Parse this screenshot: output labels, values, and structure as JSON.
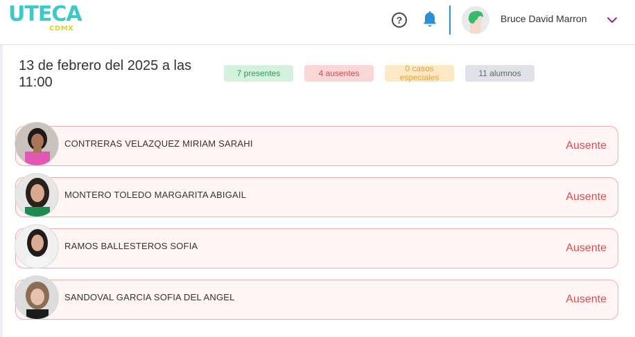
{
  "header": {
    "logo_main": "UTECA",
    "logo_sub": "CDMX",
    "help_glyph": "?",
    "user_name": "Bruce David Marron",
    "icons": [
      "question-icon",
      "bell-icon",
      "chevron-down-icon"
    ]
  },
  "title": "13 de febrero del 2025 a las 11:00",
  "badges": {
    "present": "7 presentes",
    "absent": "4 ausentes",
    "special": "0 casos especiales",
    "students": "11 alumnos"
  },
  "students": [
    {
      "name": "CONTRERAS VELAZQUEZ MIRIAM SARAHI",
      "status": "Ausente"
    },
    {
      "name": "MONTERO TOLEDO MARGARITA ABIGAIL",
      "status": "Ausente"
    },
    {
      "name": "RAMOS BALLESTEROS SOFIA",
      "status": "Ausente"
    },
    {
      "name": "SANDOVAL GARCIA SOFIA DEL ANGEL",
      "status": "Ausente"
    }
  ],
  "colors": {
    "accent": "#2a8fd6",
    "logo": "#3ec8c8",
    "logo_sub": "#d8d520",
    "absent": "#e04b4b",
    "present": "#2f9c57",
    "special": "#eaa233",
    "chevron": "#8e2a8e"
  }
}
